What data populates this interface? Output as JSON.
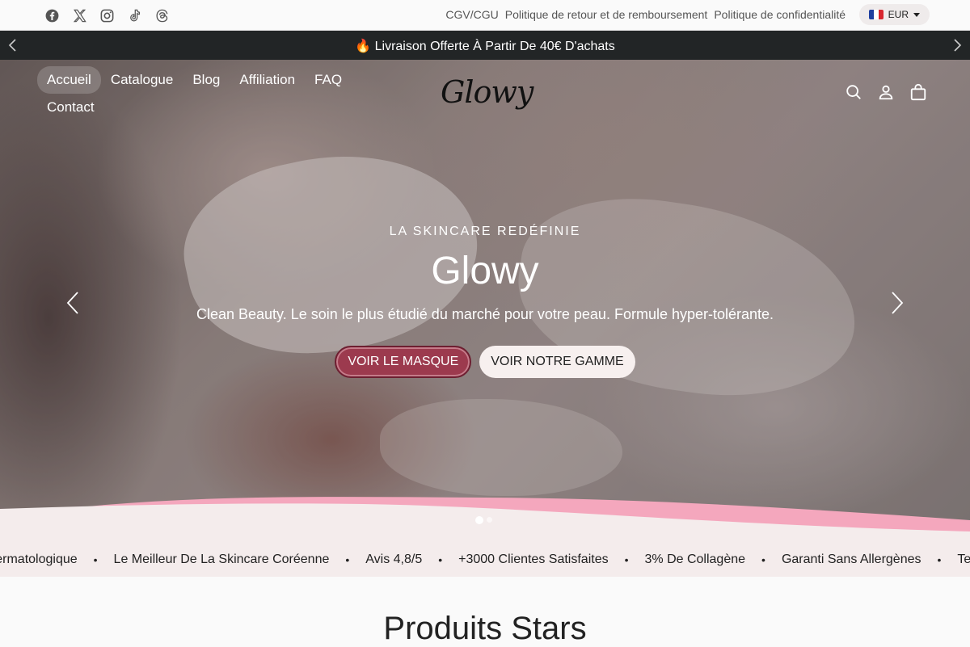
{
  "socials": [
    "facebook-icon",
    "x-icon",
    "instagram-icon",
    "tiktok-icon",
    "threads-icon"
  ],
  "top_links": [
    "CGV/CGU",
    "Politique de retour et de remboursement",
    "Politique de confidentialité"
  ],
  "currency": {
    "code": "EUR",
    "flag": "france-flag-icon"
  },
  "announcement": {
    "text": "🔥 Livraison Offerte À Partir De 40€ D'achats"
  },
  "nav": {
    "items": [
      "Accueil",
      "Catalogue",
      "Blog",
      "Affiliation",
      "FAQ",
      "Contact"
    ],
    "active": "Accueil"
  },
  "brand": {
    "logo_text": "Glowy"
  },
  "header_icons": [
    "search-icon",
    "account-icon",
    "cart-icon"
  ],
  "hero": {
    "subtitle": "LA SKINCARE REDÉFINIE",
    "title": "Glowy",
    "description": "Clean Beauty. Le soin le plus étudié du marché pour votre peau. Formule hyper-tolérante.",
    "primary_button": "VOIR LE MASQUE",
    "secondary_button": "VOIR NOTRE GAMME",
    "slides": 2,
    "active_slide": 1
  },
  "marquee": {
    "items": [
      "Testé Dermatologique",
      "Le Meilleur De La Skincare Coréenne",
      "Avis 4,8/5",
      "+3000 Clientes Satisfaites",
      "3% De Collagène",
      "Garanti Sans Allergènes",
      "Testé Dermatologique"
    ]
  },
  "section": {
    "title": "Produits Stars"
  },
  "colors": {
    "accent": "#9c3a4e",
    "wave_pink": "#f4a7bd",
    "announcement_bg": "#222526",
    "marquee_bg": "#f4ecec"
  }
}
